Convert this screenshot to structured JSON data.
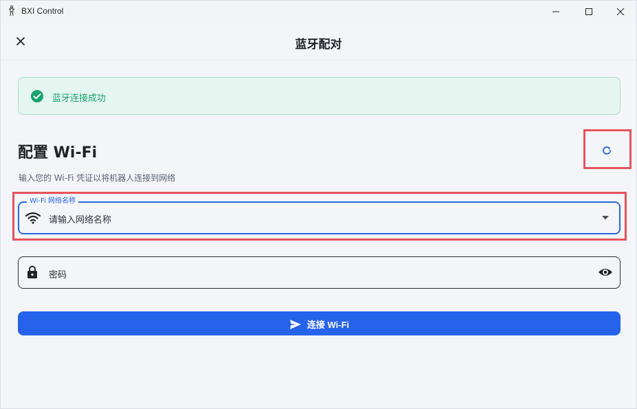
{
  "window": {
    "title": "BXI Control"
  },
  "header": {
    "title": "蓝牙配对"
  },
  "banner": {
    "message": "蓝牙连接成功"
  },
  "section": {
    "title": "配置 Wi-Fi",
    "subtitle": "输入您的 Wi-Fi 凭证以将机器人连接到网络"
  },
  "wifi": {
    "label": "Wi-Fi 网络名称",
    "placeholder": "请输入网络名称"
  },
  "password": {
    "placeholder": "密码"
  },
  "actions": {
    "connect_label": "连接 Wi-Fi"
  },
  "icons": {
    "app": "robot-icon",
    "close": "close-icon",
    "success": "check-circle-icon",
    "refresh": "refresh-icon",
    "wifi": "wifi-icon",
    "dropdown": "dropdown-icon",
    "lock": "lock-icon",
    "eye": "eye-icon",
    "send": "send-icon"
  },
  "colors": {
    "primary": "#2563eb",
    "success": "#1aa36e",
    "success_bg": "#e5f5ef",
    "highlight": "#e8525a"
  }
}
